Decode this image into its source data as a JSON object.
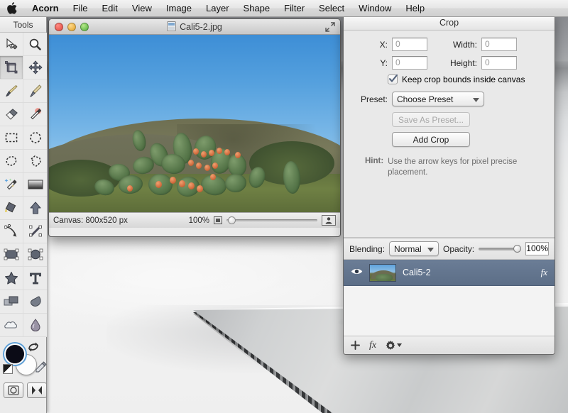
{
  "menubar": {
    "apple_icon": "apple-logo-icon",
    "items": [
      {
        "label": "Acorn",
        "bold": true
      },
      {
        "label": "File"
      },
      {
        "label": "Edit"
      },
      {
        "label": "View"
      },
      {
        "label": "Image"
      },
      {
        "label": "Layer"
      },
      {
        "label": "Shape"
      },
      {
        "label": "Filter"
      },
      {
        "label": "Select"
      },
      {
        "label": "Window"
      },
      {
        "label": "Help"
      }
    ]
  },
  "tools_panel": {
    "title": "Tools",
    "tools": [
      {
        "name": "move-selection-tool",
        "selected": false
      },
      {
        "name": "zoom-tool",
        "selected": false
      },
      {
        "name": "crop-tool",
        "selected": true
      },
      {
        "name": "pan-move-tool",
        "selected": false
      },
      {
        "name": "paintbrush-tool",
        "selected": false
      },
      {
        "name": "pencil-tool",
        "selected": false
      },
      {
        "name": "eraser-tool",
        "selected": false
      },
      {
        "name": "magic-wand-tool",
        "selected": false
      },
      {
        "name": "rectangular-selection-tool",
        "selected": false
      },
      {
        "name": "elliptical-selection-tool",
        "selected": false
      },
      {
        "name": "lasso-selection-tool",
        "selected": false
      },
      {
        "name": "polygon-selection-tool",
        "selected": false
      },
      {
        "name": "sparkle-wand-tool",
        "selected": false
      },
      {
        "name": "gradient-tool",
        "selected": false
      },
      {
        "name": "paint-bucket-tool",
        "selected": false
      },
      {
        "name": "arrow-shape-tool",
        "selected": false
      },
      {
        "name": "bezier-path-tool",
        "selected": false
      },
      {
        "name": "line-shape-tool",
        "selected": false
      },
      {
        "name": "rectangle-shape-tool",
        "selected": false
      },
      {
        "name": "ellipse-shape-tool",
        "selected": false
      },
      {
        "name": "star-shape-tool",
        "selected": false
      },
      {
        "name": "text-tool",
        "selected": false
      },
      {
        "name": "clone-stamp-tool",
        "selected": false
      },
      {
        "name": "smudge-tool",
        "selected": false
      },
      {
        "name": "blur-tool",
        "selected": false
      },
      {
        "name": "dodge-burn-tool",
        "selected": false
      }
    ],
    "colors": {
      "foreground": "#0b0b16",
      "background": "#ffffff",
      "swap_icon": "swap-colors-icon",
      "default_icon": "default-colors-icon",
      "eyedropper_icon": "eyedropper-icon"
    },
    "bottom_buttons": [
      {
        "name": "mask-mode-button",
        "icon": "circle-in-square-icon"
      },
      {
        "name": "screen-mode-button",
        "icon": "fullscreen-toggle-icon"
      }
    ]
  },
  "document_window": {
    "title": "Cali5-2.jpg",
    "doc_icon": "document-icon",
    "fullscreen_icon": "fullscreen-arrows-icon",
    "traffic_lights": [
      {
        "name": "close-button",
        "color": "#e0463c"
      },
      {
        "name": "minimize-button",
        "color": "#e0a028"
      },
      {
        "name": "zoom-button",
        "color": "#4fae3a"
      }
    ],
    "statusbar": {
      "canvas_label": "Canvas: 800x520 px",
      "zoom_level": "100%",
      "fit_icon": "fit-to-window-icon",
      "zoom_slider_value": 2,
      "person_icon": "color-profile-icon"
    }
  },
  "inspector": {
    "title": "Crop",
    "fields": [
      {
        "label": "X:",
        "value": "0",
        "name": "crop-x-input"
      },
      {
        "label": "Width:",
        "value": "0",
        "name": "crop-width-input"
      },
      {
        "label": "Y:",
        "value": "0",
        "name": "crop-y-input"
      },
      {
        "label": "Height:",
        "value": "0",
        "name": "crop-height-input"
      }
    ],
    "checkbox": {
      "label": "Keep crop bounds inside canvas",
      "checked": true
    },
    "preset": {
      "label": "Preset:",
      "value": "Choose Preset"
    },
    "save_preset_button": {
      "label": "Save As Preset...",
      "disabled": true
    },
    "add_crop_button": {
      "label": "Add Crop",
      "disabled": false
    },
    "hint": {
      "label": "Hint:",
      "text": "Use the arrow keys for pixel precise placement."
    },
    "blending": {
      "label": "Blending:",
      "mode": "Normal",
      "opacity_label": "Opacity:",
      "opacity_value": "100%",
      "opacity_percent": 100
    },
    "layers": [
      {
        "name": "Cali5-2",
        "visible": true,
        "eye_icon": "eye-icon",
        "fx_label": "fx",
        "selected": true
      }
    ],
    "layer_toolbar": [
      {
        "name": "add-layer-button",
        "label": "+"
      },
      {
        "name": "layer-effects-button",
        "label": "fx"
      },
      {
        "name": "layer-settings-button",
        "label": "gear"
      }
    ]
  },
  "colors": {
    "layer_selected": "#637490",
    "panel_bg": "#e9e9e9",
    "accent_blue": "#5e9fd6"
  }
}
